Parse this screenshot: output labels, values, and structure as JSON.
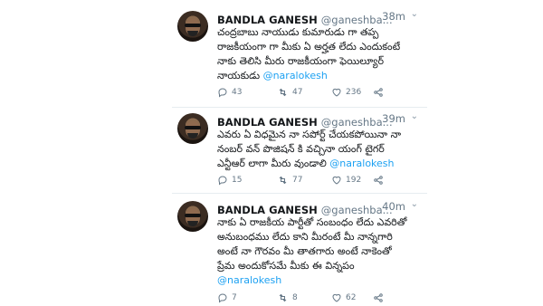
{
  "tweets": [
    {
      "name": "BANDLA GANESH",
      "handle": "@ganeshba...",
      "time": "38m",
      "lines": [
        "చంద్రబాబు నాయుడు కుమారుడు గా తప్ప",
        "రాజకీయంగా గా మీకు ఏ అర్హత లేదు ఎందుకంటే",
        "నాకు తెలిసి మీరు రాజకీయంగా ఫెయిల్యూర్",
        "నాయకుడు"
      ],
      "mention": "@naralokesh",
      "replies": "43",
      "retweets": "47",
      "likes": "236"
    },
    {
      "name": "BANDLA GANESH",
      "handle": "@ganeshba...",
      "time": "39m",
      "lines": [
        "ఎవరు ఏ విధమైన నా సపోర్ట్ చేయకపోయినా నా",
        "నంబర్ వన్ పొజిషన్ కి వచ్చినా యంగ్ టైగర్",
        "ఎన్టీఆర్ లాగా మీరు వుండాలి"
      ],
      "mention": "@naralokesh",
      "replies": "15",
      "retweets": "77",
      "likes": "192"
    },
    {
      "name": "BANDLA GANESH",
      "handle": "@ganeshba...",
      "time": "40m",
      "lines": [
        "నాకు ఏ రాజకీయ పార్టీతో సంబంధం లేదు ఎవరితో",
        "అనుబంధము లేదు కాని మీరంటే మీ నాన్నగారి",
        "అంటే నా గౌరవం మీ తాతగారు అంటే నాకెంతో",
        "ప్రేమ అందుకోసమే మీకు ఈ విన్నపం"
      ],
      "mention": "@naralokesh",
      "replies": "7",
      "retweets": "8",
      "likes": "62"
    }
  ],
  "colors": {
    "accent": "#1da1f2",
    "muted": "#657786",
    "text": "#14171a",
    "divider": "#e6ecf0"
  },
  "icons": [
    "reply-icon",
    "retweet-icon",
    "like-icon",
    "share-icon",
    "chevron-down-icon"
  ]
}
